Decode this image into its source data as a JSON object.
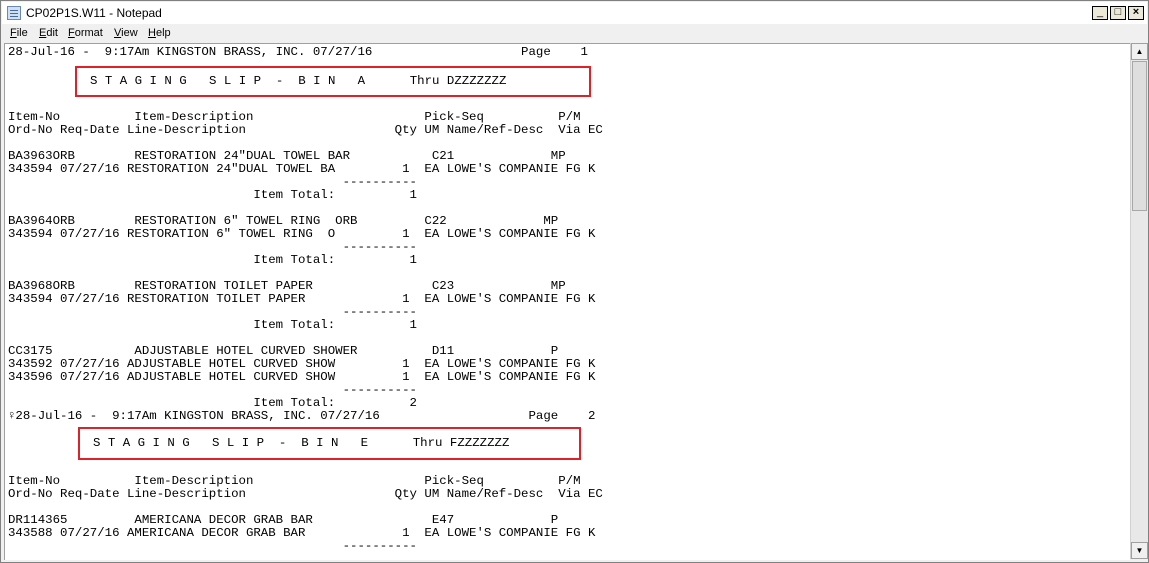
{
  "window": {
    "title": "CP02P1S.W11 - Notepad",
    "icon": "notepad-icon",
    "controls": {
      "minimize": "_",
      "maximize": "□",
      "close": "×"
    }
  },
  "menu": [
    {
      "underline": "F",
      "rest": "ile",
      "name": "menu-file"
    },
    {
      "underline": "E",
      "rest": "dit",
      "name": "menu-edit"
    },
    {
      "underline": "F",
      "rest": "ormat",
      "name": "menu-format"
    },
    {
      "underline": "V",
      "rest": "iew",
      "name": "menu-view"
    },
    {
      "underline": "H",
      "rest": "elp",
      "name": "menu-help"
    }
  ],
  "lines": [
    "28-Jul-16 -  9:17Am KINGSTON BRASS, INC. 07/27/16                    Page    1",
    "",
    "",
    "",
    "",
    "Item-No          Item-Description                       Pick-Seq          P/M",
    "Ord-No Req-Date Line-Description                    Qty UM Name/Ref-Desc  Via EC",
    "",
    "BA3963ORB        RESTORATION 24\"DUAL TOWEL BAR           C21             MP",
    "343594 07/27/16 RESTORATION 24\"DUAL TOWEL BA         1  EA LOWE'S COMPANIE FG K",
    "                                             ----------",
    "                                 Item Total:          1",
    "",
    "BA3964ORB        RESTORATION 6\" TOWEL RING  ORB         C22             MP",
    "343594 07/27/16 RESTORATION 6\" TOWEL RING  O         1  EA LOWE'S COMPANIE FG K",
    "                                             ----------",
    "                                 Item Total:          1",
    "",
    "BA3968ORB        RESTORATION TOILET PAPER                C23             MP",
    "343594 07/27/16 RESTORATION TOILET PAPER             1  EA LOWE'S COMPANIE FG K",
    "                                             ----------",
    "                                 Item Total:          1",
    "",
    "CC3175           ADJUSTABLE HOTEL CURVED SHOWER          D11             P",
    "343592 07/27/16 ADJUSTABLE HOTEL CURVED SHOW         1  EA LOWE'S COMPANIE FG K",
    "343596 07/27/16 ADJUSTABLE HOTEL CURVED SHOW         1  EA LOWE'S COMPANIE FG K",
    "                                             ----------",
    "                                 Item Total:          2",
    "♀28-Jul-16 -  9:17Am KINGSTON BRASS, INC. 07/27/16                    Page    2",
    "",
    "",
    "",
    "",
    "Item-No          Item-Description                       Pick-Seq          P/M",
    "Ord-No Req-Date Line-Description                    Qty UM Name/Ref-Desc  Via EC",
    "",
    "DR114365         AMERICANA DECOR GRAB BAR                E47             P",
    "343588 07/27/16 AMERICANA DECOR GRAB BAR             1  EA LOWE'S COMPANIE FG K",
    "                                             ----------"
  ],
  "slips": [
    {
      "text": "S T A G I N G   S L I P  -  B I N   A      Thru DZZZZZZZ"
    },
    {
      "text": "S T A G I N G   S L I P  -  B I N   E      Thru FZZZZZZZ"
    }
  ]
}
